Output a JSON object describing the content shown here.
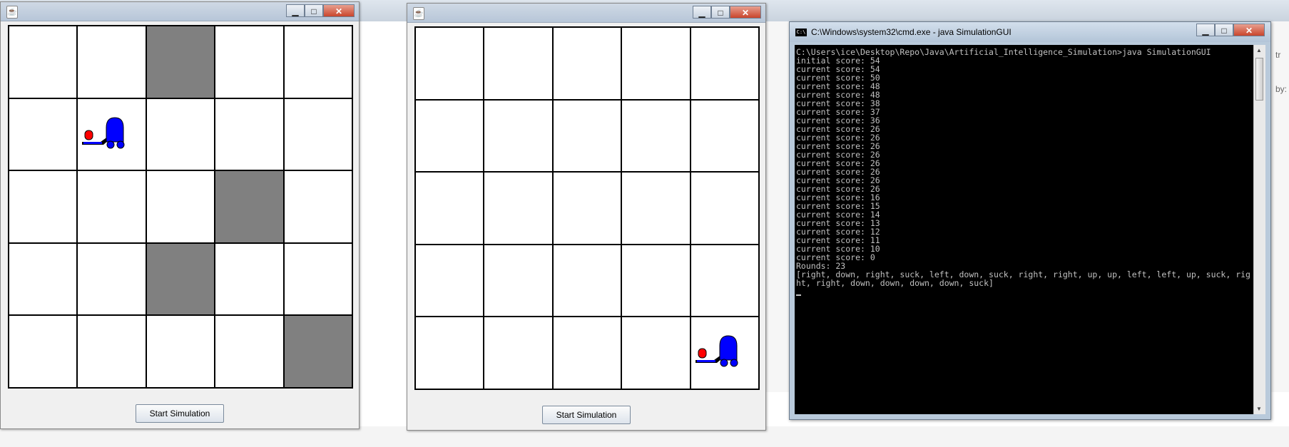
{
  "frames": [
    {
      "title_icon": "java-icon",
      "controls": {
        "minimize": "▁",
        "maximize": "□",
        "close": "✕"
      },
      "grid": {
        "rows": 5,
        "cols": 5,
        "dirty_cells": [
          [
            0,
            2
          ],
          [
            2,
            3
          ],
          [
            3,
            2
          ],
          [
            4,
            4
          ]
        ],
        "vacuum_cell": [
          1,
          1
        ]
      },
      "button_label": "Start Simulation"
    },
    {
      "title_icon": "java-icon",
      "controls": {
        "minimize": "▁",
        "maximize": "□",
        "close": "✕"
      },
      "grid": {
        "rows": 5,
        "cols": 5,
        "dirty_cells": [],
        "vacuum_cell": [
          4,
          4
        ]
      },
      "button_label": "Start Simulation"
    }
  ],
  "cmd": {
    "title": "C:\\Windows\\system32\\cmd.exe - java  SimulationGUI",
    "controls": {
      "minimize": "▁",
      "maximize": "□",
      "close": "✕"
    },
    "output": "C:\\Users\\ice\\Desktop\\Repo\\Java\\Artificial_Intelligence_Simulation>java SimulationGUI\ninitial score: 54\ncurrent score: 54\ncurrent score: 50\ncurrent score: 48\ncurrent score: 48\ncurrent score: 38\ncurrent score: 37\ncurrent score: 36\ncurrent score: 26\ncurrent score: 26\ncurrent score: 26\ncurrent score: 26\ncurrent score: 26\ncurrent score: 26\ncurrent score: 26\ncurrent score: 26\ncurrent score: 16\ncurrent score: 15\ncurrent score: 14\ncurrent score: 13\ncurrent score: 12\ncurrent score: 11\ncurrent score: 10\ncurrent score: 0\nRounds: 23\n[right, down, right, suck, left, down, suck, right, right, up, up, left, left, up, suck, right, right, down, down, down, down, suck]\n"
  },
  "background": {
    "right_hint_1": "by:",
    "right_hint_2": "tr"
  },
  "colors": {
    "dirty": "#808080",
    "vacuum_body": "#0000ff",
    "vacuum_light": "#ff0000"
  }
}
